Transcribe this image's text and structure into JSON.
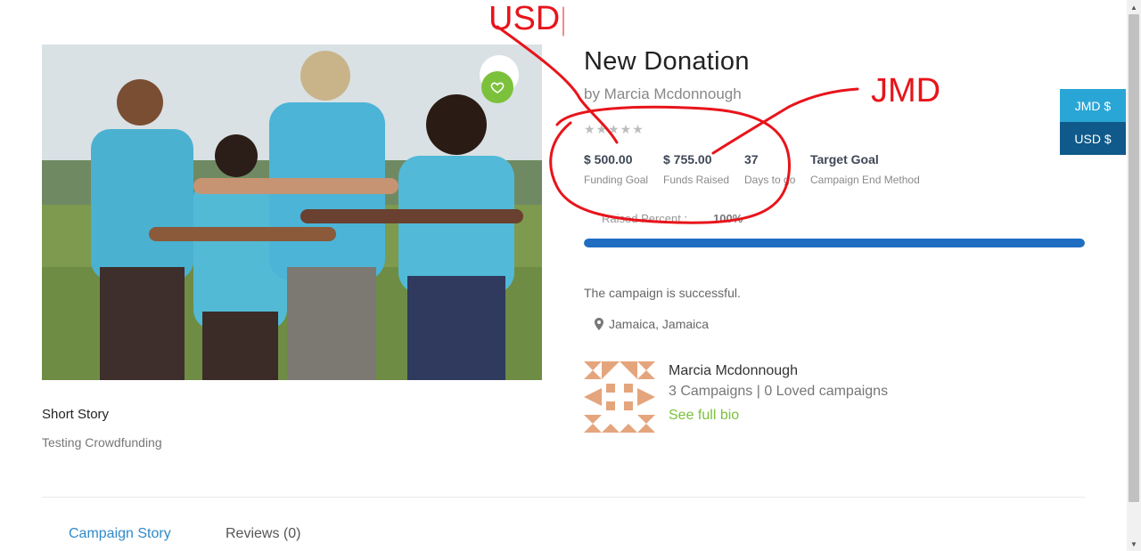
{
  "campaign": {
    "title": "New Donation",
    "byline": "by Marcia Mcdonnough",
    "rating_stars": "★★★★★",
    "funding_goal_value": "$ 500.00",
    "funding_goal_label": "Funding Goal",
    "funds_raised_value": "$ 755.00",
    "funds_raised_label": "Funds Raised",
    "days_value": "37",
    "days_label": "Days to go",
    "end_method_value": "Target Goal",
    "end_method_label": "Campaign End Method",
    "raised_percent_label": "Raised Percent :",
    "raised_percent_value": "100%",
    "raised_percent_fraction": 1.0,
    "status": "The campaign is successful.",
    "location": "Jamaica, Jamaica"
  },
  "story": {
    "title": "Short Story",
    "text": "Testing Crowdfunding"
  },
  "author": {
    "name": "Marcia Mcdonnough",
    "stats": "3 Campaigns | 0 Loved campaigns",
    "bio_link": "See full bio"
  },
  "tabs": [
    {
      "label": "Campaign Story"
    },
    {
      "label": "Reviews (0)"
    }
  ],
  "currency": {
    "jmd": "JMD $",
    "usd": "USD $"
  },
  "annotations": {
    "usd": "USD",
    "jmd": "JMD"
  },
  "colors": {
    "accent_green": "#7cc13b",
    "progress_blue": "#1f6ec2",
    "tab_active": "#2f8ac9",
    "currency_jmd": "#2aa6d6",
    "currency_usd": "#0f5a8a",
    "annotation_red": "#e8141b"
  },
  "icons": {
    "love": "heart-icon",
    "location": "map-pin-icon"
  }
}
